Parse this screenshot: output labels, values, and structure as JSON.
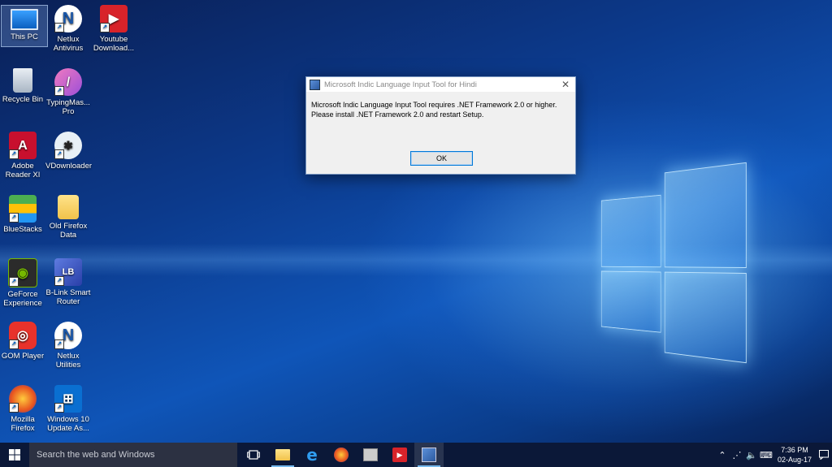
{
  "desktop": {
    "icons": [
      {
        "label": "This PC",
        "glyph": "computer-icon"
      },
      {
        "label": "Netlux\nAntivirus",
        "glyph": "netlux-icon"
      },
      {
        "label": "Youtube\nDownload...",
        "glyph": "youtube-downloader-icon"
      },
      {
        "label": "Recycle Bin",
        "glyph": "recycle-bin-icon"
      },
      {
        "label": "TypingMas...\nPro",
        "glyph": "typingmaster-icon"
      },
      {
        "label": "Adobe\nReader XI",
        "glyph": "adobe-reader-icon"
      },
      {
        "label": "VDownloader",
        "glyph": "vdownloader-icon"
      },
      {
        "label": "BlueStacks",
        "glyph": "bluestacks-icon"
      },
      {
        "label": "Old Firefox\nData",
        "glyph": "folder-icon"
      },
      {
        "label": "GeForce\nExperience",
        "glyph": "geforce-icon"
      },
      {
        "label": "B-Link Smart\nRouter",
        "glyph": "blink-router-icon"
      },
      {
        "label": "GOM Player",
        "glyph": "gom-player-icon"
      },
      {
        "label": "Netlux\nUtilities",
        "glyph": "netlux-icon"
      },
      {
        "label": "Mozilla\nFirefox",
        "glyph": "firefox-icon"
      },
      {
        "label": "Windows 10\nUpdate As...",
        "glyph": "windows-update-icon"
      }
    ]
  },
  "dialog": {
    "title": "Microsoft Indic Language Input Tool for Hindi",
    "line1": "Microsoft Indic Language Input Tool requires .NET Framework 2.0 or higher.",
    "line2": "Please install .NET Framework 2.0 and restart Setup.",
    "ok_label": "OK",
    "close_glyph": "✕"
  },
  "taskbar": {
    "search_placeholder": "Search the web and Windows",
    "time": "7:36 PM",
    "date": "02-Aug-17"
  },
  "colors": {
    "accent": "#0078d7",
    "taskbar": "#0b1838"
  }
}
